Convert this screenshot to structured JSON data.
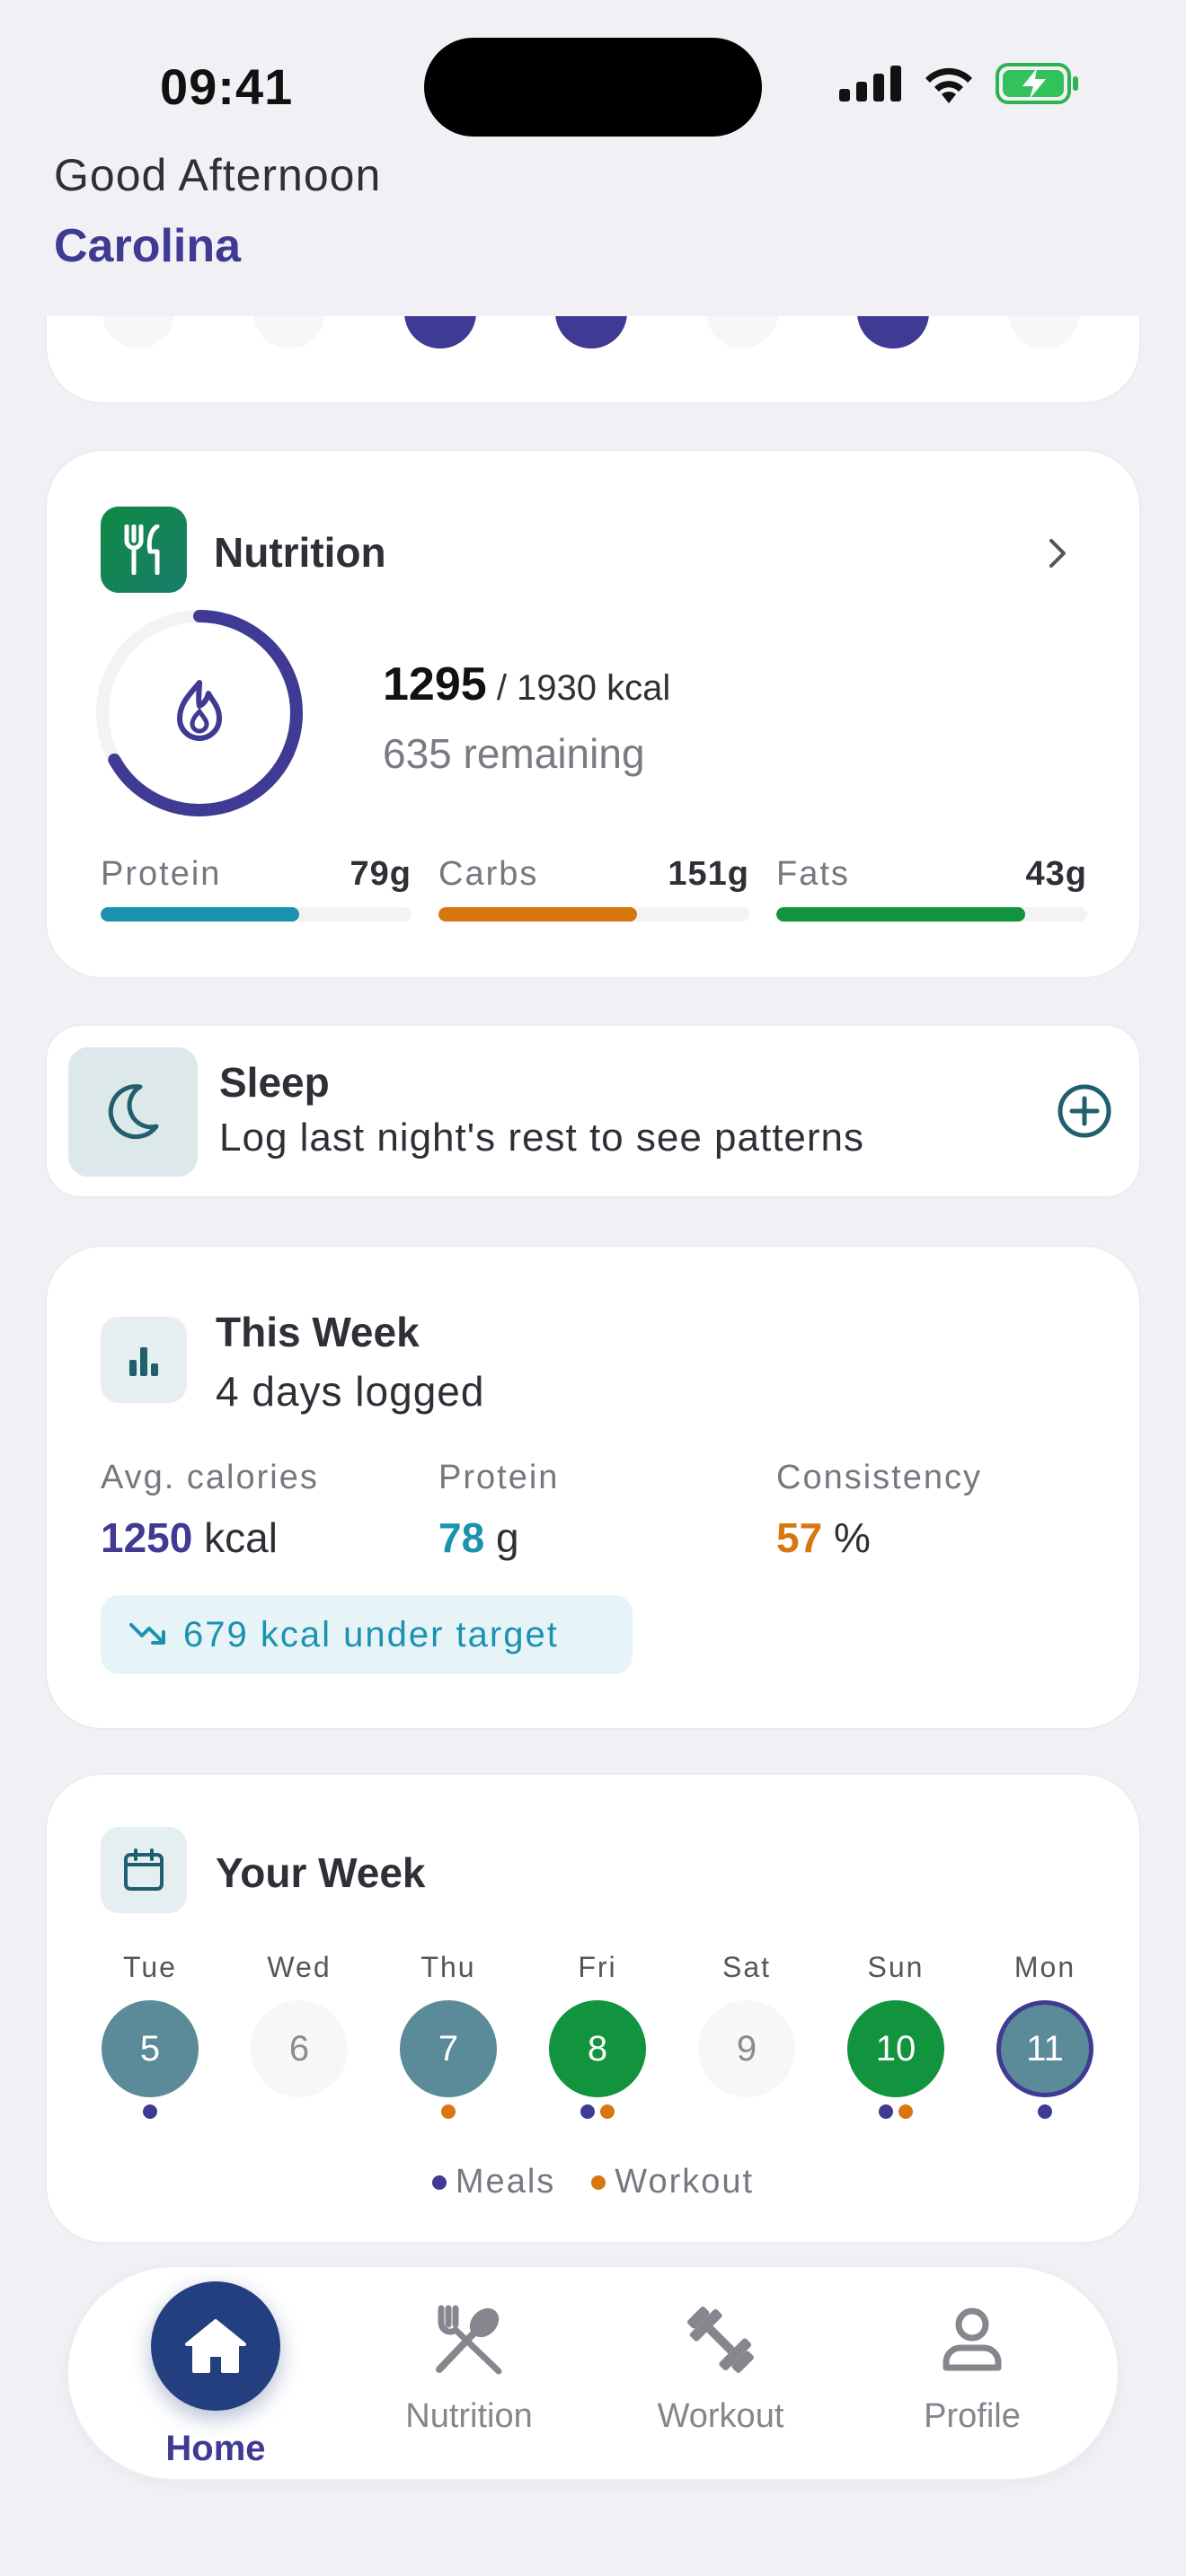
{
  "status_bar": {
    "time": "09:41"
  },
  "header": {
    "greeting": "Good Afternoon",
    "name": "Carolina"
  },
  "nutrition": {
    "title": "Nutrition",
    "consumed": "1295",
    "target_text": "/ 1930 kcal",
    "remaining_text": "635 remaining",
    "progress": 0.67,
    "macros": [
      {
        "label": "Protein",
        "value": "79g",
        "progress": 0.64,
        "color": "#1a92b0"
      },
      {
        "label": "Carbs",
        "value": "151g",
        "progress": 0.64,
        "color": "#d9770f"
      },
      {
        "label": "Fats",
        "value": "43g",
        "progress": 0.8,
        "color": "#12933e"
      }
    ]
  },
  "sleep": {
    "title": "Sleep",
    "subtitle": "Log last night's rest to see patterns"
  },
  "this_week": {
    "title": "This Week",
    "subtitle": "4 days logged",
    "stats": [
      {
        "label": "Avg. calories",
        "value": "1250",
        "unit": "kcal",
        "color": "#3f3a93"
      },
      {
        "label": "Protein",
        "value": "78",
        "unit": "g",
        "color": "#1a92b0"
      },
      {
        "label": "Consistency",
        "value": "57",
        "unit": "%",
        "color": "#d9770f"
      }
    ],
    "badge": "679 kcal under target"
  },
  "your_week": {
    "title": "Your Week",
    "days": [
      {
        "name": "Tue",
        "num": "5",
        "state": "logged",
        "meals": true,
        "workout": false
      },
      {
        "name": "Wed",
        "num": "6",
        "state": "empty",
        "meals": false,
        "workout": false
      },
      {
        "name": "Thu",
        "num": "7",
        "state": "logged",
        "meals": false,
        "workout": true
      },
      {
        "name": "Fri",
        "num": "8",
        "state": "complete",
        "meals": true,
        "workout": true
      },
      {
        "name": "Sat",
        "num": "9",
        "state": "empty",
        "meals": false,
        "workout": false
      },
      {
        "name": "Sun",
        "num": "10",
        "state": "complete",
        "meals": true,
        "workout": true
      },
      {
        "name": "Mon",
        "num": "11",
        "state": "today",
        "meals": true,
        "workout": false
      }
    ],
    "legend": {
      "meals": "Meals",
      "workout": "Workout"
    }
  },
  "nav": {
    "home": "Home",
    "nutrition": "Nutrition",
    "workout": "Workout",
    "profile": "Profile"
  },
  "colors": {
    "primary": "#3f3a93",
    "teal": "#1a92b0",
    "orange": "#d9770f",
    "green": "#12933e",
    "slate": "#5b8b98"
  }
}
